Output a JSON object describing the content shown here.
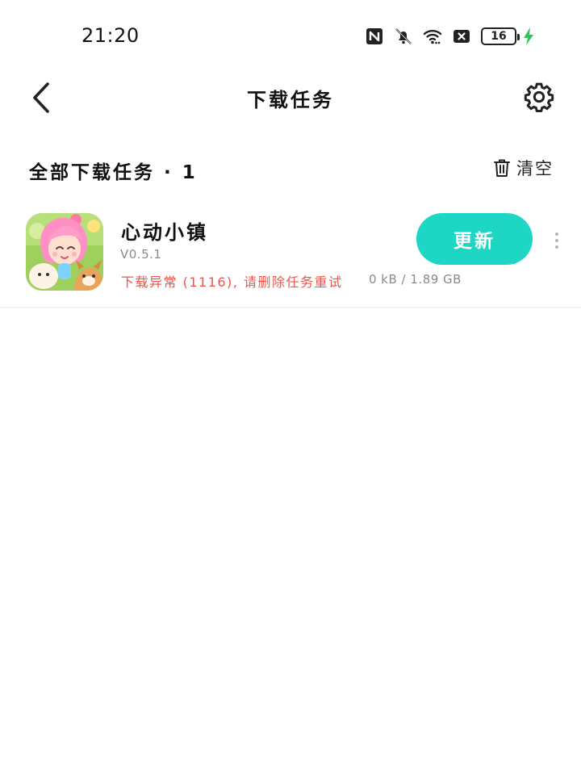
{
  "status_bar": {
    "time": "21:20",
    "battery_level": "16",
    "icons": [
      "nfc-icon",
      "mute-icon",
      "wifi-icon",
      "sim-icon",
      "battery-icon",
      "charging-icon"
    ]
  },
  "header": {
    "title": "下载任务",
    "back_icon": "chevron-left-icon",
    "settings_icon": "gear-icon"
  },
  "section": {
    "title": "全部下载任务 · 1",
    "clear_label": "清空",
    "clear_icon": "trash-icon"
  },
  "downloads": [
    {
      "name": "心动小镇",
      "version": "V0.5.1",
      "error": "下载异常 (1116), 请删除任务重试",
      "size": "0 kB / 1.89 GB",
      "action_label": "更新",
      "more_icon": "more-vertical-icon"
    }
  ],
  "colors": {
    "accent": "#1dd6c3",
    "error": "#f0534b",
    "charging": "#2fc35a",
    "secondary_text": "#8a8a8a"
  }
}
